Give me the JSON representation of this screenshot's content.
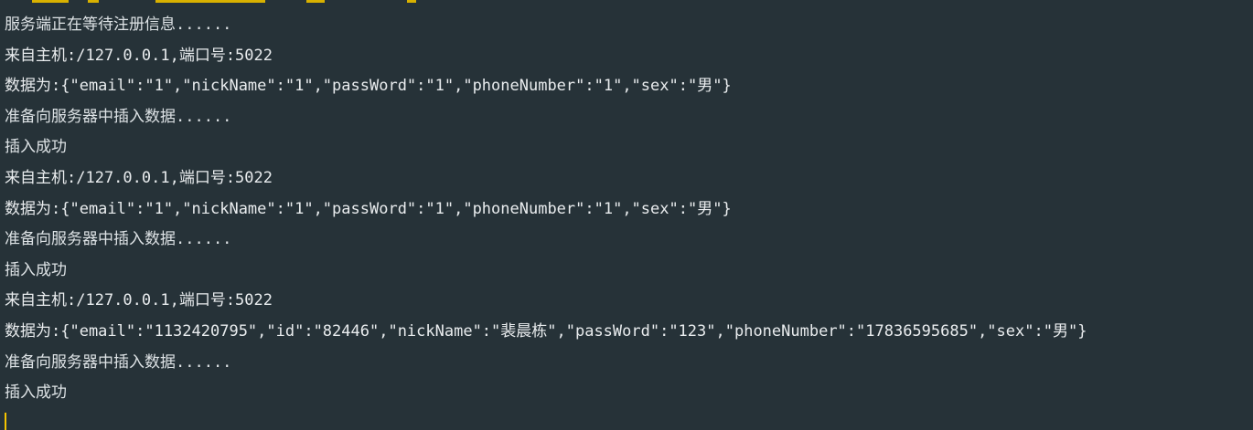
{
  "console": {
    "lines": [
      "服务端正在等待注册信息......",
      "来自主机:/127.0.0.1,端口号:5022",
      "数据为:{\"email\":\"1\",\"nickName\":\"1\",\"passWord\":\"1\",\"phoneNumber\":\"1\",\"sex\":\"男\"}",
      "准备向服务器中插入数据......",
      "插入成功",
      "来自主机:/127.0.0.1,端口号:5022",
      "数据为:{\"email\":\"1\",\"nickName\":\"1\",\"passWord\":\"1\",\"phoneNumber\":\"1\",\"sex\":\"男\"}",
      "准备向服务器中插入数据......",
      "插入成功",
      "来自主机:/127.0.0.1,端口号:5022",
      "数据为:{\"email\":\"1132420795\",\"id\":\"82446\",\"nickName\":\"裴晨栋\",\"passWord\":\"123\",\"phoneNumber\":\"17836595685\",\"sex\":\"男\"}",
      "准备向服务器中插入数据......",
      "插入成功"
    ]
  },
  "colors": {
    "background": "#263238",
    "text": "#e9ecee",
    "caret": "#f5c400",
    "top_strip": "#d8b100"
  }
}
